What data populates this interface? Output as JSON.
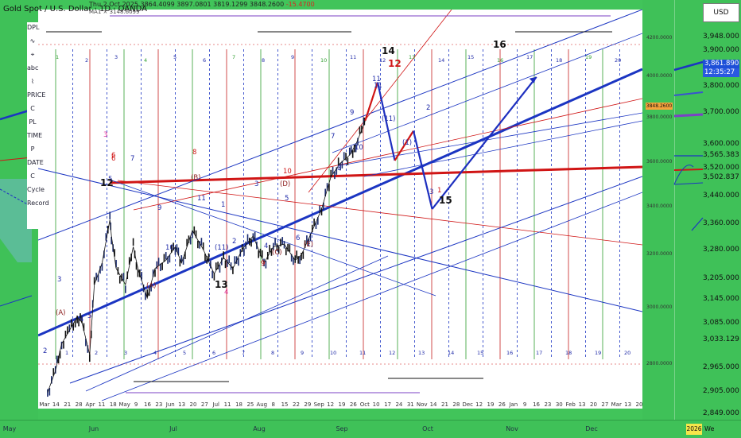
{
  "window": {
    "title": "Gold Spot / U.S. Dollar · 1D · OANDA",
    "ohlc": {
      "time": "Thu 2 Oct 2025",
      "open": "3864.4099",
      "high": "3897.0801",
      "low": "3819.1299",
      "close": "3848.2600",
      "change": "-15.4700"
    },
    "ma_label": "MA1 × 3148.6099"
  },
  "toolbar": {
    "items": [
      "DPL",
      "∿",
      "⌖",
      "abc",
      "⌇",
      "PRICE",
      "C",
      "PL",
      "TIME",
      "P",
      "DATE",
      "C",
      "Cycle",
      "Record"
    ]
  },
  "price_scale": {
    "currency": "USD",
    "labels": [
      "3,948.000",
      "3,900.000",
      "3,800.000",
      "3,700.000",
      "3,600.000",
      "3,565.383",
      "3,520.000",
      "3,502.837",
      "3,440.000",
      "3,360.000",
      "3,280.000",
      "3,205.000",
      "3,145.000",
      "3,085.000",
      "3,033.129",
      "2,965.000",
      "2,905.000",
      "2,849.000"
    ],
    "last_price": "3,861.890",
    "countdown": "12:35:27"
  },
  "inner_scale": {
    "labels": [
      "4200.0000",
      "4000.0000",
      "3800.0000",
      "3600.0000",
      "3400.0000",
      "3200.0000",
      "3000.0000",
      "2800.0000"
    ],
    "current": "3848.2600"
  },
  "time_axis": {
    "outer": [
      "May",
      "Jun",
      "Jul",
      "Aug",
      "Sep",
      "Oct",
      "Nov",
      "Dec",
      "2026",
      "We"
    ],
    "inner": [
      "Mar",
      "14",
      "21",
      "28",
      "Apr",
      "11",
      "18",
      "May",
      "9",
      "16",
      "23",
      "Jun",
      "13",
      "20",
      "27",
      "Jul",
      "11",
      "18",
      "25",
      "Aug",
      "8",
      "15",
      "22",
      "29",
      "Sep",
      "12",
      "19",
      "26",
      "Oct",
      "10",
      "17",
      "24",
      "31",
      "Nov",
      "14",
      "21",
      "28",
      "Dec",
      "12",
      "19",
      "26",
      "Jan",
      "9",
      "16",
      "23",
      "30",
      "Feb",
      "13",
      "20",
      "27",
      "Mar",
      "13",
      "20"
    ]
  },
  "annotations": {
    "wave_labels": [
      "2",
      "(A)",
      "3",
      "4",
      "5",
      "12",
      "7",
      "(A)",
      "6",
      "9",
      "10",
      "(B)",
      "11",
      "1",
      "2",
      "(11)",
      "3",
      "4",
      "(D)",
      "5",
      "(C)",
      "6",
      "(E)",
      "7",
      "8",
      "9",
      "10",
      "11",
      "(11)",
      "12",
      "(1)",
      "2",
      "3",
      "1",
      "13",
      "15",
      "14",
      "16",
      "3",
      "6",
      "8",
      "10",
      "9",
      "11",
      "4",
      "5"
    ],
    "cycle_numbers": [
      "1",
      "2",
      "3",
      "4",
      "5",
      "6",
      "7",
      "8",
      "9",
      "10",
      "11",
      "12",
      "13",
      "14",
      "15",
      "16",
      "17",
      "18",
      "19",
      "20"
    ]
  },
  "chart_data": {
    "type": "line",
    "title": "Gold Spot / U.S. Dollar · 1D · OANDA",
    "xlabel": "",
    "ylabel": "",
    "ylim": [
      2780,
      4260
    ],
    "x_range": [
      "2025-03-10",
      "2026-03-25"
    ],
    "series": [
      {
        "name": "XAUUSD",
        "x": [
          "2025-03-12",
          "2025-03-17",
          "2025-03-21",
          "2025-03-26",
          "2025-03-31",
          "2025-04-03",
          "2025-04-08",
          "2025-04-11",
          "2025-04-16",
          "2025-04-21",
          "2025-04-22",
          "2025-04-25",
          "2025-05-01",
          "2025-05-06",
          "2025-05-09",
          "2025-05-15",
          "2025-05-20",
          "2025-05-27",
          "2025-06-02",
          "2025-06-06",
          "2025-06-13",
          "2025-06-20",
          "2025-06-27",
          "2025-07-03",
          "2025-07-09",
          "2025-07-15",
          "2025-07-22",
          "2025-07-29",
          "2025-08-04",
          "2025-08-11",
          "2025-08-18",
          "2025-08-22",
          "2025-08-29",
          "2025-09-04",
          "2025-09-10",
          "2025-09-16",
          "2025-09-22",
          "2025-09-26",
          "2025-10-01",
          "2025-10-02"
        ],
        "values": [
          2840,
          2920,
          3020,
          3070,
          3120,
          3100,
          2980,
          3240,
          3320,
          3480,
          3420,
          3300,
          3240,
          3380,
          3300,
          3190,
          3300,
          3330,
          3380,
          3320,
          3440,
          3370,
          3280,
          3340,
          3300,
          3370,
          3420,
          3320,
          3380,
          3390,
          3330,
          3350,
          3440,
          3520,
          3640,
          3690,
          3720,
          3760,
          3830,
          3848
        ]
      },
      {
        "name": "Projection",
        "x": [
          "2025-10-02",
          "2025-10-10",
          "2025-10-21",
          "2025-11-02",
          "2025-11-14",
          "2026-01-20"
        ],
        "values": [
          3848,
          3990,
          3700,
          3810,
          3520,
          4010
        ]
      }
    ]
  },
  "colors": {
    "background": "#41c45a",
    "plot": "#ffffff",
    "projection": "#1d2fbf",
    "wave_red": "#d01515",
    "wave_blue": "#1f2aa8",
    "trend_thick": "#1b35c2"
  }
}
